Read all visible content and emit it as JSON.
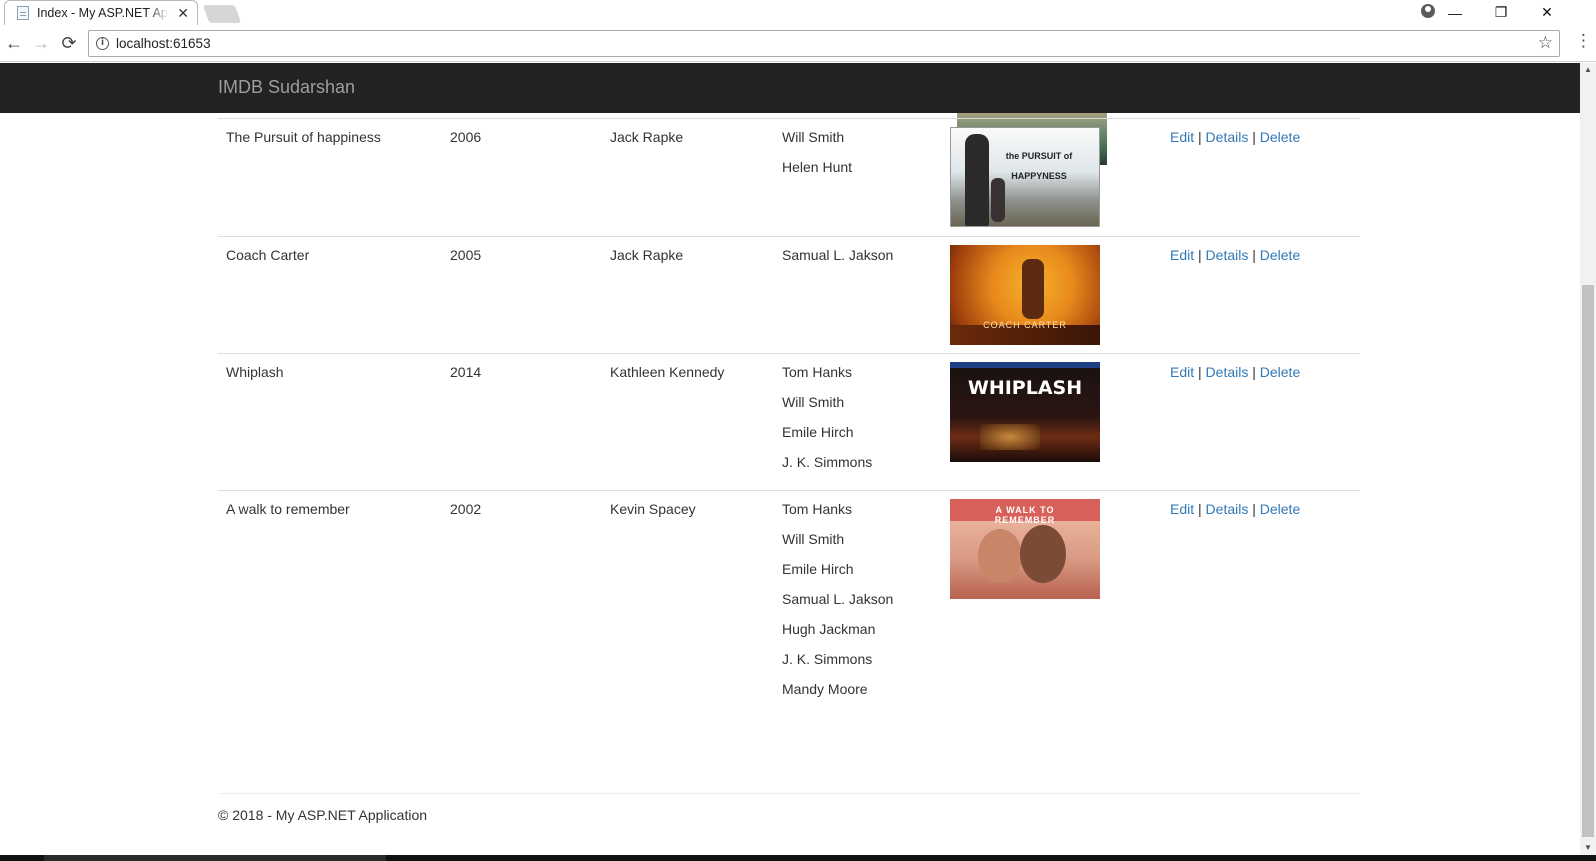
{
  "browser": {
    "tab_title": "Index - My ASP.NET Application",
    "tab_close": "✕",
    "address": "localhost:61653",
    "back": "←",
    "forward": "→",
    "reload": "⟳",
    "star": "☆",
    "menu": "⋮",
    "minimize": "—",
    "restore": "❐",
    "close": "✕"
  },
  "navbar": {
    "brand": "IMDB Sudarshan"
  },
  "actions": {
    "edit": "Edit",
    "details": "Details",
    "delete": "Delete",
    "separator": "|"
  },
  "movies": [
    {
      "title": "The Pursuit of happiness",
      "year": "2006",
      "producer": "Jack Rapke",
      "actors": [
        "Will Smith",
        "Helen Hunt"
      ],
      "poster_caption": "the PURSUIT of HAPPYNESS"
    },
    {
      "title": "Coach Carter",
      "year": "2005",
      "producer": "Jack Rapke",
      "actors": [
        "Samual L. Jakson"
      ],
      "poster_caption": "COACH CARTER"
    },
    {
      "title": "Whiplash",
      "year": "2014",
      "producer": "Kathleen Kennedy",
      "actors": [
        "Tom Hanks",
        "Will Smith",
        "Emile Hirch",
        "J. K. Simmons"
      ],
      "poster_caption": "WHIPLASH"
    },
    {
      "title": "A walk to remember",
      "year": "2002",
      "producer": "Kevin Spacey",
      "actors": [
        "Tom Hanks",
        "Will Smith",
        "Emile Hirch",
        "Samual L. Jakson",
        "Hugh Jackman",
        "J. K. Simmons",
        "Mandy Moore"
      ],
      "poster_caption": "A WALK TO REMEMBER"
    }
  ],
  "footer": {
    "text": "© 2018 - My ASP.NET Application"
  },
  "colors": {
    "navbar_bg": "#222222",
    "link": "#337ab7",
    "brand_text": "#9d9d9d"
  }
}
